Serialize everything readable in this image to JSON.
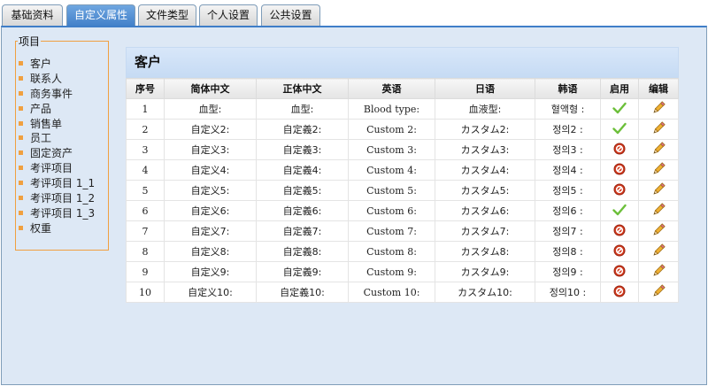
{
  "tabs": [
    {
      "label": "基础资料",
      "active": false
    },
    {
      "label": "自定义属性",
      "active": true
    },
    {
      "label": "文件类型",
      "active": false
    },
    {
      "label": "个人设置",
      "active": false
    },
    {
      "label": "公共设置",
      "active": false
    }
  ],
  "nav": {
    "legend": "项目",
    "items": [
      "客户",
      "联系人",
      "商务事件",
      "产品",
      "销售单",
      "员工",
      "固定资产",
      "考评项目",
      "考评项目 1_1",
      "考评项目 1_2",
      "考评项目 1_3",
      "权重"
    ]
  },
  "content": {
    "title": "客户",
    "columns": [
      "序号",
      "简体中文",
      "正体中文",
      "英语",
      "日语",
      "韩语",
      "启用",
      "编辑"
    ],
    "rows": [
      {
        "no": "1",
        "zh_cn": "血型:",
        "zh_tw": "血型:",
        "en": "Blood type:",
        "ja": "血液型:",
        "ko": "혈액형 :",
        "enabled": true
      },
      {
        "no": "2",
        "zh_cn": "自定义2:",
        "zh_tw": "自定義2:",
        "en": "Custom 2:",
        "ja": "カスタム2:",
        "ko": "정의2 :",
        "enabled": true
      },
      {
        "no": "3",
        "zh_cn": "自定义3:",
        "zh_tw": "自定義3:",
        "en": "Custom 3:",
        "ja": "カスタム3:",
        "ko": "정의3 :",
        "enabled": false
      },
      {
        "no": "4",
        "zh_cn": "自定义4:",
        "zh_tw": "自定義4:",
        "en": "Custom 4:",
        "ja": "カスタム4:",
        "ko": "정의4 :",
        "enabled": false
      },
      {
        "no": "5",
        "zh_cn": "自定义5:",
        "zh_tw": "自定義5:",
        "en": "Custom 5:",
        "ja": "カスタム5:",
        "ko": "정의5 :",
        "enabled": false
      },
      {
        "no": "6",
        "zh_cn": "自定义6:",
        "zh_tw": "自定義6:",
        "en": "Custom 6:",
        "ja": "カスタム6:",
        "ko": "정의6 :",
        "enabled": true
      },
      {
        "no": "7",
        "zh_cn": "自定义7:",
        "zh_tw": "自定義7:",
        "en": "Custom 7:",
        "ja": "カスタム7:",
        "ko": "정의7 :",
        "enabled": false
      },
      {
        "no": "8",
        "zh_cn": "自定义8:",
        "zh_tw": "自定義8:",
        "en": "Custom 8:",
        "ja": "カスタム8:",
        "ko": "정의8 :",
        "enabled": false
      },
      {
        "no": "9",
        "zh_cn": "自定义9:",
        "zh_tw": "自定義9:",
        "en": "Custom 9:",
        "ja": "カスタム9:",
        "ko": "정의9 :",
        "enabled": false
      },
      {
        "no": "10",
        "zh_cn": "自定义10:",
        "zh_tw": "自定義10:",
        "en": "Custom 10:",
        "ja": "カスタム10:",
        "ko": "정의10 :",
        "enabled": false
      }
    ]
  },
  "icons": {
    "enabled": "check-icon",
    "disabled": "disabled-icon",
    "edit": "pencil-icon"
  },
  "colors": {
    "tab_active": "#3f7ec8",
    "panel_bg": "#dde8f5",
    "nav_accent": "#f0a040",
    "check": "#6cbf3a",
    "disabled": "#d23a1e"
  }
}
